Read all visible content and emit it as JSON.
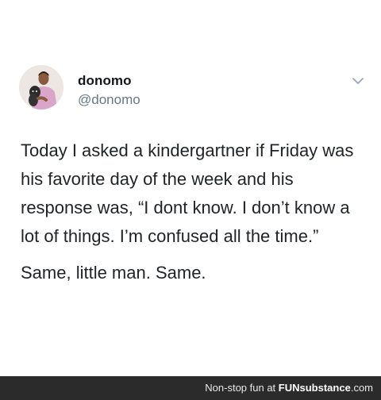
{
  "tweet": {
    "display_name": "donomo",
    "handle": "@donomo",
    "paragraphs": [
      "Today I asked a kindergartner if Friday was his favorite day of the week and his response was, “I dont know. I don’t know a lot of things. I’m confused all the time.”",
      "Same, little man. Same."
    ],
    "avatar_icon": "profile-photo",
    "menu_icon": "chevron-down-icon"
  },
  "footer": {
    "tagline": "Non-stop fun at",
    "brand_prefix": "FUN",
    "brand_suffix": "substance",
    "brand_domain": ".com"
  },
  "colors": {
    "background": "#ffffff",
    "name": "#14171a",
    "handle": "#657786",
    "body_text": "#1f2326",
    "footer_bg": "#2b2b2b"
  }
}
